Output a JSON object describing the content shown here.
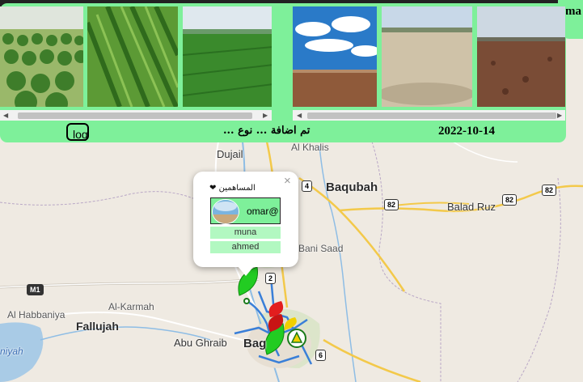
{
  "header": {
    "log_button": "log",
    "added_text": "تم اضافة ... نوع ...",
    "date": "2022-10-14",
    "corner_text": "ma"
  },
  "map": {
    "places": {
      "dujail": "Dujail",
      "al_khalis": "Al Khalis",
      "baqubah": "Baqubah",
      "balad_ruz": "Balad Ruz",
      "bani_saad": "Bani Saad",
      "al_habbaniya": "Al Habbaniya",
      "fallujah": "Fallujah",
      "al_karmah": "Al-Karmah",
      "abu_ghraib": "Abu Ghraib",
      "baghdad": "Bag",
      "lake": "niyah"
    },
    "routes": {
      "r4": "4",
      "r82a": "82",
      "r82b": "82",
      "r82c": "82",
      "r2": "2",
      "r6": "6",
      "m1": "M1"
    }
  },
  "popup": {
    "close": "×",
    "contributors_label": "المساهمين",
    "main_user": "omar@",
    "others": [
      "muna",
      "ahmed"
    ]
  },
  "colors": {
    "accent": "#7ef09a",
    "accent_light": "#b2f8c1",
    "road": "#f3c94a",
    "route_blue": "#3a7fd8"
  }
}
